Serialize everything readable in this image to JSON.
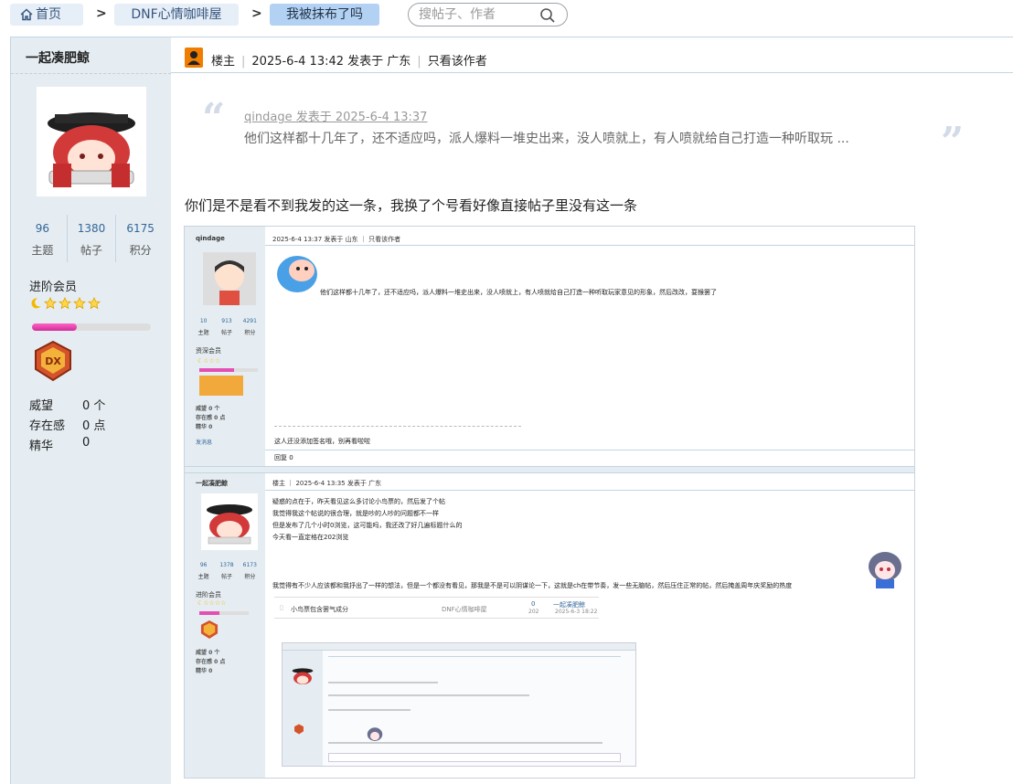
{
  "breadcrumb": {
    "home": "首页",
    "forum": "DNF心情咖啡屋",
    "current": "我被抹布了吗",
    "separator": ">"
  },
  "search": {
    "placeholder": "搜帖子、作者"
  },
  "author": {
    "name": "一起凑肥鲸",
    "stats": [
      {
        "value": "96",
        "label": "主题"
      },
      {
        "value": "1380",
        "label": "帖子"
      },
      {
        "value": "6175",
        "label": "积分"
      }
    ],
    "group": "进阶会员",
    "level_progress": 0.38,
    "meta": [
      {
        "key": "威望",
        "value": "0 个"
      },
      {
        "key": "存在感",
        "value": "0 点"
      },
      {
        "key": "精华",
        "value": "0"
      }
    ]
  },
  "post": {
    "role": "楼主",
    "time": "2025-6-4 13:42",
    "posted_from": "发表于 广东",
    "only_author": "只看该作者",
    "quote_author": "qindage 发表于 2025-6-4 13:37",
    "quote_text": "他们这样都十几年了，还不适应吗，派人爆料一堆史出来，没人喷就上，有人喷就给自己打造一种听取玩 ...",
    "reply": "你们是不是看不到我发的这一条，我换了个号看好像直接帖子里没有这一条"
  },
  "screenshot": {
    "post1": {
      "user": "qindage",
      "head": "2025-6-4 13:37 发表于 山东 ｜ 只看该作者",
      "stats": [
        "10",
        "913",
        "4291"
      ],
      "stat_labels": [
        "主题",
        "帖子",
        "积分"
      ],
      "group": "资深会员",
      "meta": [
        "威望 0 个",
        "存在感 0 点",
        "精华 0"
      ],
      "send_msg": "发消息",
      "text": "他们这样都十几年了，还不适应吗，派人爆料一堆史出来，没人喷就上，有人喷就给自己打造一种听取玩家意见的形象，然后改改，耍猴罢了",
      "signature": "这人还没添加签名哦，别再看啦啦",
      "actions": "回复  0"
    },
    "post2": {
      "user": "一起凑肥鲸",
      "head": "楼主 ｜ 2025-6-4 13:35 发表于 广东",
      "stats": [
        "96",
        "1378",
        "6173"
      ],
      "stat_labels": [
        "主题",
        "帖子",
        "积分"
      ],
      "group": "进阶会员",
      "meta": [
        "威望 0 个",
        "存在感 0 点",
        "精华 0"
      ],
      "lines": [
        "疑惑的点在于，昨天看见这么多讨论小鸟票的，然后发了个帖",
        "我觉得我这个帖说的很合理，就是吵的人吵的问题都不一样",
        "但是发布了几个小时0浏览，这可能吗，我还改了好几遍标题什么的",
        "今天看一直定格在202浏览"
      ],
      "long_line": "我觉得有不少人应该都和我抒出了一样的想法，但是一个都没有看见，那我是不是可以阴谋论一下，这就是ch在带节奏，发一些无脑帖，然后压住正常的帖，然后掩盖周年庆奖励的热度",
      "thread_title": "小鸟票包含罢气成分",
      "thread_forum": "DNF心情咖啡屋",
      "thread_count": "0",
      "thread_views": "202",
      "thread_last": "一起凑肥鲸",
      "thread_last_time": "2025-6-3 18:22"
    }
  },
  "colors": {
    "accent": "#369",
    "sidebar_bg": "#e5edf2",
    "crumb_bg": "#e6eef7",
    "crumb_current_bg": "#b3d1f2",
    "border": "#c2d5e3"
  }
}
